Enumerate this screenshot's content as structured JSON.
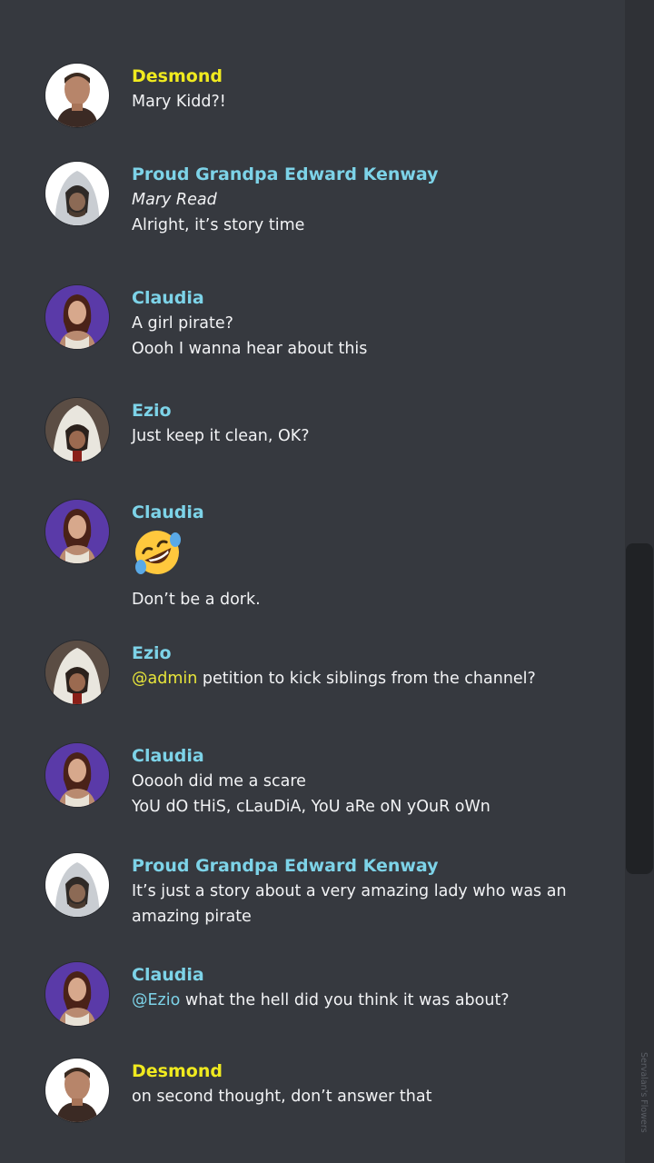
{
  "colors": {
    "background": "#36393f",
    "desmond": "#f0ea1f",
    "cyan_user": "#7dd3e8",
    "text": "#f2f3f5",
    "mention_yellow": "#e8e63a",
    "claudia_avatar_bg": "#5a3aa8"
  },
  "messages": [
    {
      "author": "Desmond",
      "lines": [
        "Mary Kidd?!"
      ]
    },
    {
      "author": "Proud Grandpa Edward Kenway",
      "lines": [
        "Mary Read",
        "Alright, it’s story time"
      ]
    },
    {
      "author": "Claudia",
      "lines": [
        "A girl pirate?",
        "Oooh I wanna hear about this"
      ]
    },
    {
      "author": "Ezio",
      "lines": [
        "Just keep it clean, OK?"
      ]
    },
    {
      "author": "Claudia",
      "emoji": "rolling-on-floor-laughing-emoji",
      "lines": [
        "Don’t be a dork."
      ]
    },
    {
      "author": "Ezio",
      "mention": "@admin",
      "lines": [
        " petition to kick siblings from the channel?"
      ]
    },
    {
      "author": "Claudia",
      "lines": [
        "Ooooh did me a scare",
        "YoU dO tHiS, cLauDiA, YoU aRe oN yOuR oWn"
      ]
    },
    {
      "author": "Proud Grandpa Edward Kenway",
      "lines": [
        "It’s just a story about a very amazing lady who was an",
        "amazing pirate"
      ]
    },
    {
      "author": "Claudia",
      "mention": "@Ezio",
      "lines": [
        " what the hell did you think it was about?"
      ]
    },
    {
      "author": "Desmond",
      "lines": [
        "on second thought, don’t answer that"
      ]
    }
  ],
  "watermark": "Servalan's Flowers"
}
